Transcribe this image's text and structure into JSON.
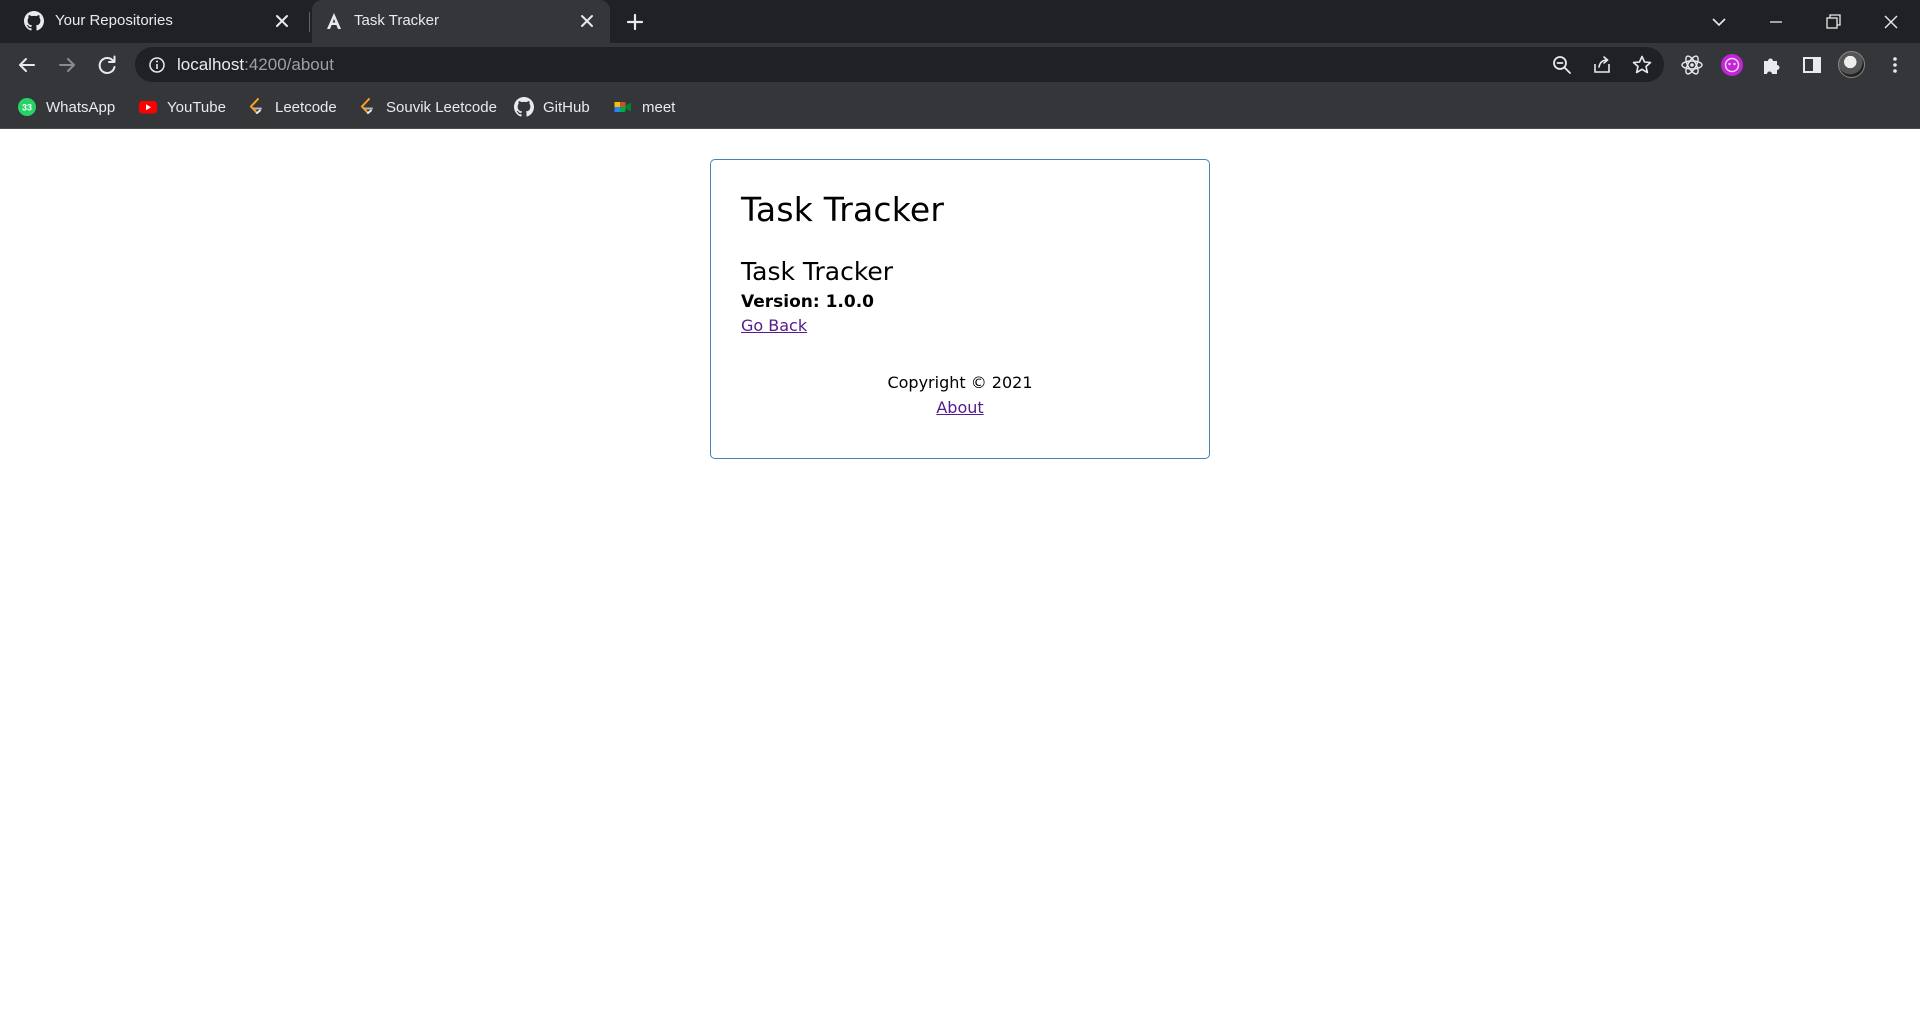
{
  "browser": {
    "tabs": [
      {
        "title": "Your Repositories",
        "favicon": "github-icon",
        "active": false
      },
      {
        "title": "Task Tracker",
        "favicon": "angular-icon",
        "active": true
      }
    ],
    "address": {
      "host": "localhost",
      "path": ":4200/about"
    },
    "bookmarks": [
      {
        "label": "WhatsApp",
        "icon": "whatsapp-icon"
      },
      {
        "label": "YouTube",
        "icon": "youtube-icon"
      },
      {
        "label": "Leetcode",
        "icon": "leetcode-icon"
      },
      {
        "label": "Souvik Leetcode",
        "icon": "leetcode-icon"
      },
      {
        "label": "GitHub",
        "icon": "github-icon"
      },
      {
        "label": "meet",
        "icon": "google-meet-icon"
      }
    ],
    "whatsapp_badge": "33",
    "colors": {
      "tabstrip": "#202124",
      "toolbar": "#35363a",
      "text": "#e8eaed",
      "card_border": "#4682b4",
      "link": "#551a8b"
    }
  },
  "page": {
    "header_title": "Task Tracker",
    "about": {
      "title": "Task Tracker",
      "version_text": "Version: 1.0.0",
      "go_back": "Go Back"
    },
    "footer": {
      "copyright": "Copyright © 2021",
      "about_link": "About"
    }
  }
}
